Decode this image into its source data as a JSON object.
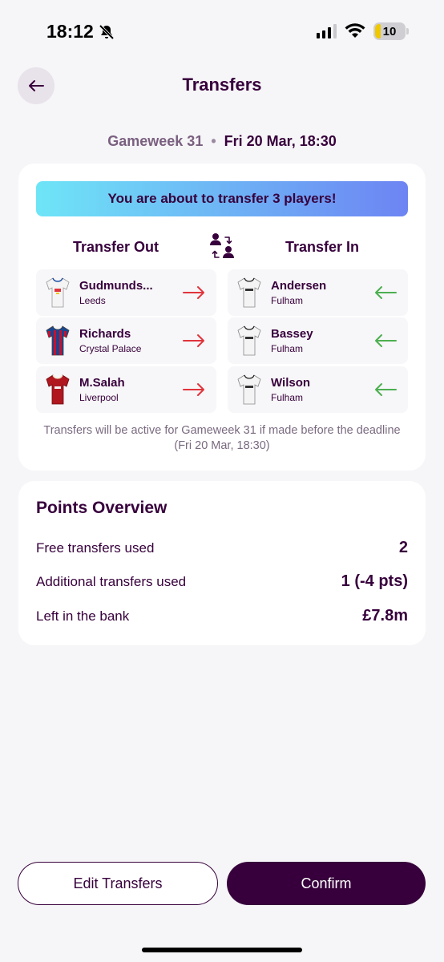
{
  "status_bar": {
    "time": "18:12",
    "battery": "10"
  },
  "header": {
    "title": "Transfers"
  },
  "gameweek": {
    "label": "Gameweek 31",
    "separator": "•",
    "deadline": "Fri 20 Mar, 18:30"
  },
  "banner": "You are about to transfer 3 players!",
  "columns": {
    "out": "Transfer Out",
    "in": "Transfer In"
  },
  "transfers_out": [
    {
      "name": "Gudmunds...",
      "club": "Leeds",
      "shirt_primary": "#f4f4f4",
      "shirt_secondary": "#1d4fa3"
    },
    {
      "name": "Richards",
      "club": "Crystal Palace",
      "shirt_primary": "#1b458f",
      "shirt_secondary": "#c4122e"
    },
    {
      "name": "M.Salah",
      "club": "Liverpool",
      "shirt_primary": "#b0171f",
      "shirt_secondary": "#8c1218"
    }
  ],
  "transfers_in": [
    {
      "name": "Andersen",
      "club": "Fulham",
      "shirt_primary": "#f4f4f4",
      "shirt_secondary": "#222222"
    },
    {
      "name": "Bassey",
      "club": "Fulham",
      "shirt_primary": "#f4f4f4",
      "shirt_secondary": "#222222"
    },
    {
      "name": "Wilson",
      "club": "Fulham",
      "shirt_primary": "#f4f4f4",
      "shirt_secondary": "#222222"
    }
  ],
  "note": "Transfers will be active for Gameweek 31 if made before the deadline (Fri 20 Mar, 18:30)",
  "points_overview": {
    "title": "Points Overview",
    "rows": [
      {
        "label": "Free transfers used",
        "value": "2"
      },
      {
        "label": "Additional transfers used",
        "value": "1 (-4 pts)"
      },
      {
        "label": "Left in the bank",
        "value": "£7.8m"
      }
    ]
  },
  "buttons": {
    "edit": "Edit Transfers",
    "confirm": "Confirm"
  },
  "colors": {
    "accent": "#37003c",
    "out_arrow": "#e0343c",
    "in_arrow": "#4caf50",
    "banner_start": "#6ee5f7",
    "banner_end": "#6d84f3"
  },
  "icons": {
    "back": "arrow-left-icon",
    "swap": "swap-players-icon",
    "out_arrow": "arrow-right-icon",
    "in_arrow": "arrow-left-icon",
    "bell": "bell-slash-icon"
  }
}
